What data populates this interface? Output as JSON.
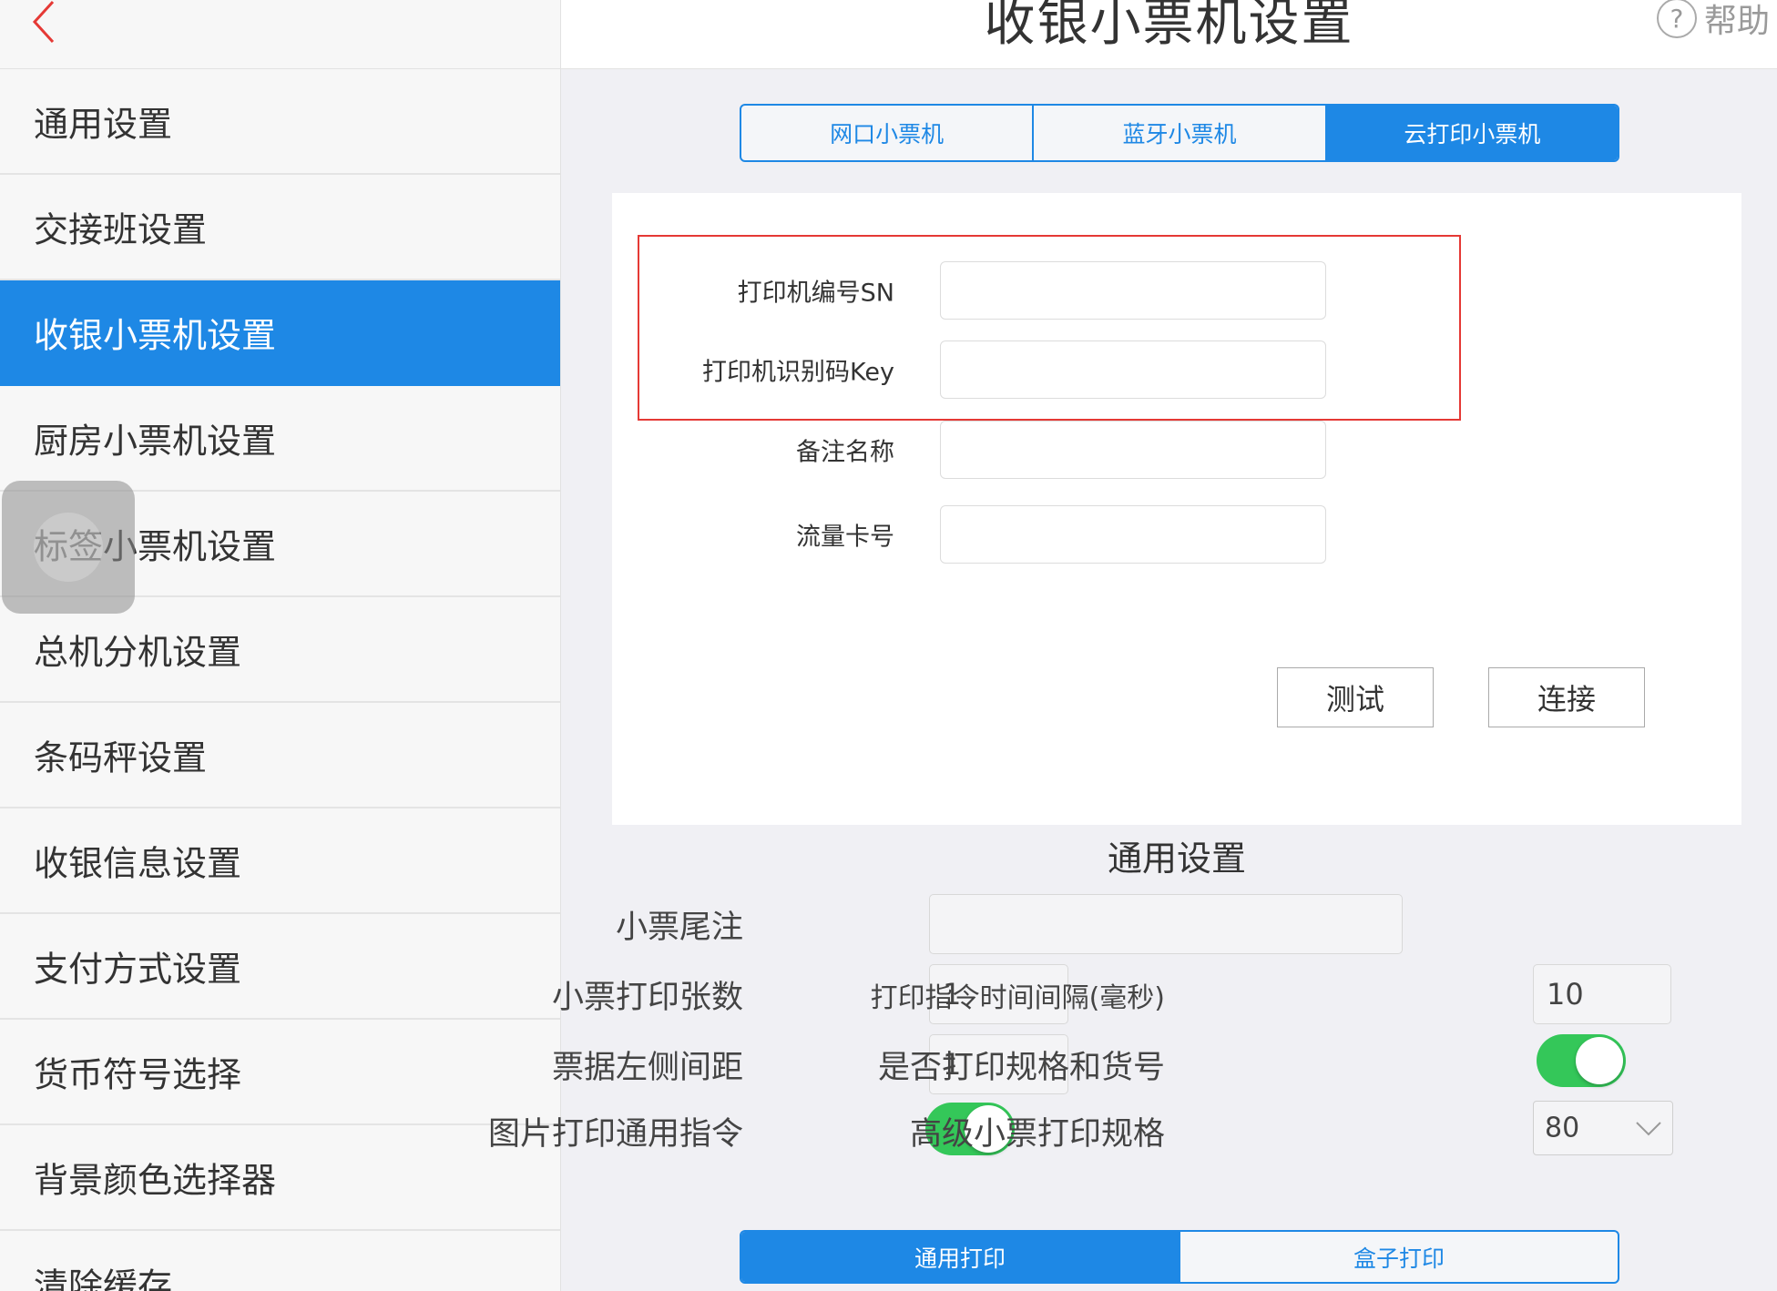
{
  "header": {
    "title": "收银小票机设置",
    "help_label": "帮助",
    "help_icon_glyph": "?"
  },
  "sidebar": {
    "items": [
      {
        "label": "通用设置"
      },
      {
        "label": "交接班设置"
      },
      {
        "label": "收银小票机设置",
        "active": true
      },
      {
        "label": "厨房小票机设置"
      },
      {
        "label": "标签小票机设置"
      },
      {
        "label": "总机分机设置"
      },
      {
        "label": "条码秤设置"
      },
      {
        "label": "收银信息设置"
      },
      {
        "label": "支付方式设置"
      },
      {
        "label": "货币符号选择"
      },
      {
        "label": "背景颜色选择器"
      },
      {
        "label": "清除缓存"
      }
    ]
  },
  "printer_tabs": [
    {
      "label": "网口小票机"
    },
    {
      "label": "蓝牙小票机"
    },
    {
      "label": "云打印小票机",
      "active": true
    }
  ],
  "cloud_printer_form": {
    "sn": {
      "label": "打印机编号SN",
      "value": ""
    },
    "key": {
      "label": "打印机识别码Key",
      "value": ""
    },
    "remark": {
      "label": "备注名称",
      "value": ""
    },
    "sim": {
      "label": "流量卡号",
      "value": ""
    },
    "test_button": "测试",
    "connect_button": "连接"
  },
  "general_settings": {
    "title": "通用设置",
    "receipt_footer": {
      "label": "小票尾注",
      "value": ""
    },
    "print_copies": {
      "label": "小票打印张数",
      "value": "1"
    },
    "left_margin": {
      "label": "票据左侧间距",
      "value": "1"
    },
    "image_cmd": {
      "label": "图片打印通用指令",
      "on": true
    },
    "cmd_interval": {
      "label": "打印指令时间间隔(毫秒)",
      "value": "10"
    },
    "print_spec_sku": {
      "label": "是否打印规格和货号",
      "on": true
    },
    "advanced_spec": {
      "label": "高级小票打印规格",
      "value": "80"
    }
  },
  "print_mode_tabs": [
    {
      "label": "通用打印",
      "active": true
    },
    {
      "label": "盒子打印"
    }
  ],
  "colors": {
    "accent": "#1e88e5",
    "toggle_on": "#34c759",
    "highlight": "#e53935"
  }
}
